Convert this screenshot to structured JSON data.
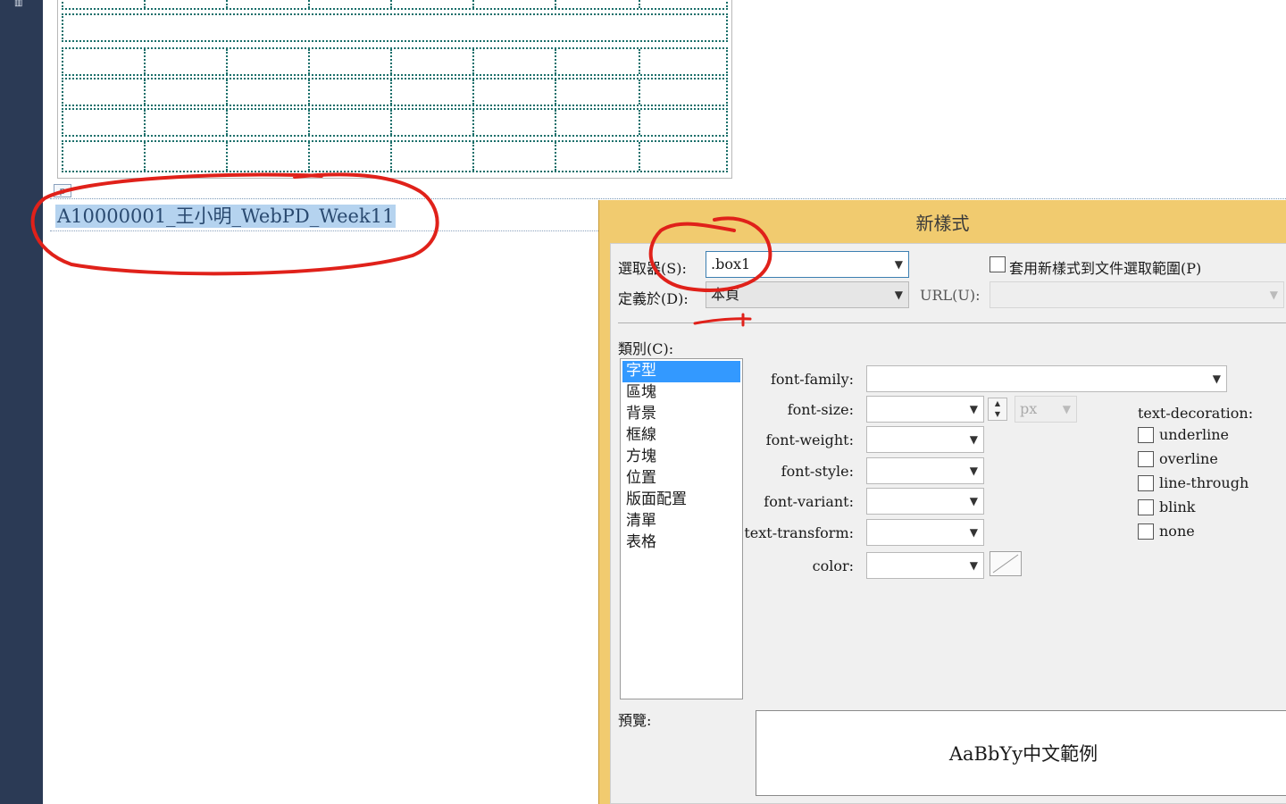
{
  "editor": {
    "tag_label": "p",
    "selected_text": "A10000001_王小明_WebPD_Week11"
  },
  "sidebar": {
    "icon": "toolbox-icon"
  },
  "dialog": {
    "title": "新樣式",
    "selector_label": "選取器(S):",
    "selector_value": ".box1",
    "apply_label": "套用新樣式到文件選取範圍(P)",
    "define_in_label": "定義於(D):",
    "define_in_value": "本頁",
    "url_label": "URL(U):",
    "url_value": "",
    "category_label": "類別(C):",
    "categories": [
      "字型",
      "區塊",
      "背景",
      "框線",
      "方塊",
      "位置",
      "版面配置",
      "清單",
      "表格"
    ],
    "selected_category": "字型",
    "fields": {
      "font_family": "font-family:",
      "font_size": "font-size:",
      "font_size_unit": "px",
      "font_weight": "font-weight:",
      "font_style": "font-style:",
      "font_variant": "font-variant:",
      "text_transform": "text-transform:",
      "color": "color:"
    },
    "text_decoration": {
      "label": "text-decoration:",
      "options": [
        "underline",
        "overline",
        "line-through",
        "blink",
        "none"
      ]
    },
    "preview_label": "預覽:",
    "preview_text": "AaBbYy中文範例"
  },
  "annotation_color": "#e0211a"
}
